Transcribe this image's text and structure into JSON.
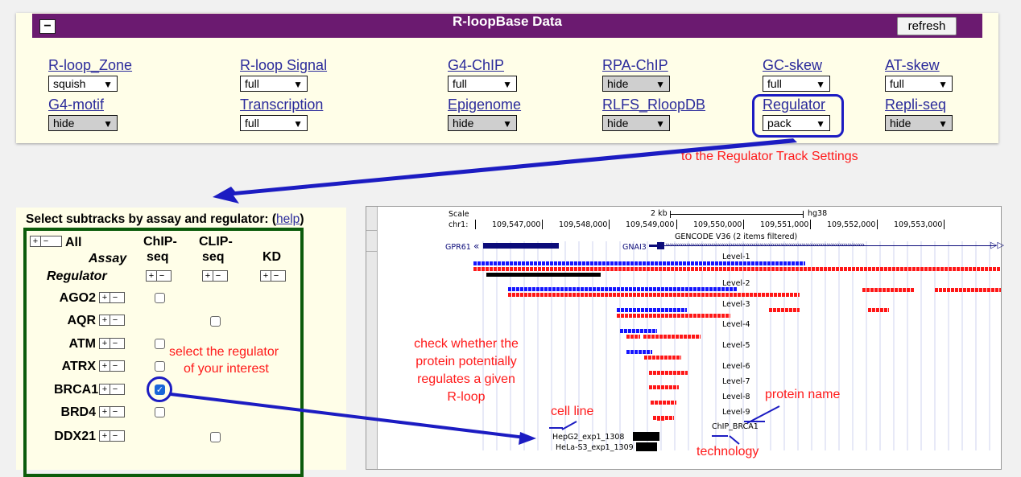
{
  "top": {
    "title": "R-loopBase Data",
    "collapse_label": "−",
    "refresh_label": "refresh",
    "row1": [
      {
        "label": "R-loop_Zone",
        "value": "squish",
        "gray": false
      },
      {
        "label": "R-loop Signal",
        "value": "full",
        "gray": false
      },
      {
        "label": "G4-ChIP",
        "value": "full",
        "gray": false
      },
      {
        "label": "RPA-ChIP",
        "value": "hide",
        "gray": true
      },
      {
        "label": "GC-skew",
        "value": "full",
        "gray": false
      },
      {
        "label": "AT-skew",
        "value": "full",
        "gray": false
      }
    ],
    "row2": [
      {
        "label": "G4-motif",
        "value": "hide",
        "gray": true
      },
      {
        "label": "Transcription",
        "value": "full",
        "gray": false
      },
      {
        "label": "Epigenome",
        "value": "hide",
        "gray": true
      },
      {
        "label": "RLFS_RloopDB",
        "value": "hide",
        "gray": true
      },
      {
        "label": "Regulator",
        "value": "pack",
        "gray": false
      },
      {
        "label": "Repli-seq",
        "value": "hide",
        "gray": true
      }
    ]
  },
  "subtracks": {
    "title": "Select subtracks by assay and regulator:",
    "help": "help",
    "all_label": "All",
    "assay_label": "Assay",
    "regulator_label": "Regulator",
    "columns": [
      {
        "line1": "ChIP-",
        "line2": "seq"
      },
      {
        "line1": "CLIP-",
        "line2": "seq"
      },
      {
        "line1": "",
        "line2": "KD"
      }
    ],
    "rows": [
      {
        "name": "AGO2",
        "chip": true,
        "chip_checked": false,
        "clip": false,
        "clip_checked": false
      },
      {
        "name": "AQR",
        "chip": false,
        "chip_checked": false,
        "clip": true,
        "clip_checked": false
      },
      {
        "name": "ATM",
        "chip": true,
        "chip_checked": false,
        "clip": false,
        "clip_checked": false
      },
      {
        "name": "ATRX",
        "chip": true,
        "chip_checked": false,
        "clip": false,
        "clip_checked": false
      },
      {
        "name": "BRCA1",
        "chip": true,
        "chip_checked": true,
        "clip": false,
        "clip_checked": false
      },
      {
        "name": "BRD4",
        "chip": true,
        "chip_checked": false,
        "clip": false,
        "clip_checked": false
      },
      {
        "name": "DDX21",
        "chip": false,
        "chip_checked": false,
        "clip": true,
        "clip_checked": false
      }
    ]
  },
  "browser": {
    "scale_label": "Scale",
    "scale_bar_label": "2 kb",
    "assembly": "hg38",
    "chrom_label": "chr1:",
    "coords": [
      "109,547,000",
      "109,548,000",
      "109,549,000",
      "109,550,000",
      "109,551,000",
      "109,552,000",
      "109,553,000"
    ],
    "gencode_label": "GENCODE V36 (2 items filtered)",
    "gene1": "GPR61",
    "gene2": "GNAI3",
    "levels": [
      "Level-1",
      "Level-2",
      "Level-3",
      "Level-4",
      "Level-5",
      "Level-6",
      "Level-7",
      "Level-8",
      "Level-9"
    ],
    "chip_label": "ChIP_BRCA1",
    "sample1": "HepG2_exp1_1308",
    "sample2": "HeLa-S3_exp1_1309"
  },
  "annotations": {
    "regulator_track": "to the Regulator Track Settings",
    "select_line1": "select the regulator",
    "select_line2": "of your interest",
    "check_lines": [
      "check whether the",
      "protein potentially",
      "regulates a given",
      "R-loop"
    ],
    "cell_line": "cell line",
    "protein_name": "protein name",
    "technology": "technology"
  },
  "colors": {
    "header_purple": "#6b1a70",
    "link_blue": "#2b2b9b",
    "highlight_blue": "#1c1cc2",
    "annotation_red": "#ff1a1a",
    "track_green": "#0b5b0b",
    "rloop_blue": "#1515ff",
    "rloop_red": "#ff1717"
  }
}
